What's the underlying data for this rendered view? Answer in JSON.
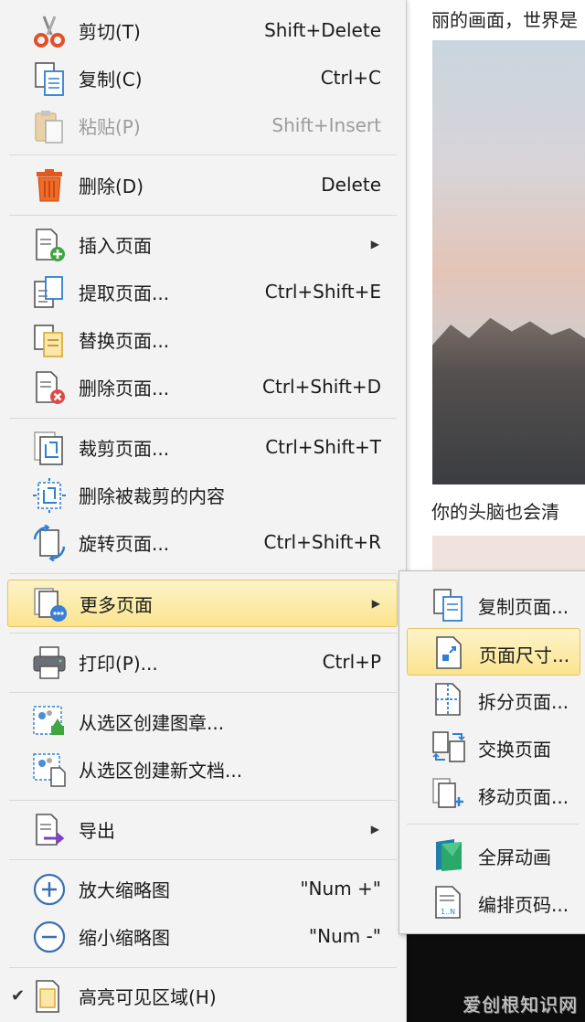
{
  "document": {
    "line1": "丽的画面，世界是",
    "line2": "你的头脑也会清",
    "watermark": "爱创根知识网"
  },
  "menu": {
    "items": [
      {
        "id": "cut",
        "label": "剪切(T)",
        "shortcut": "Shift+Delete"
      },
      {
        "id": "copy",
        "label": "复制(C)",
        "shortcut": "Ctrl+C"
      },
      {
        "id": "paste",
        "label": "粘贴(P)",
        "shortcut": "Shift+Insert"
      },
      {
        "id": "delete",
        "label": "删除(D)",
        "shortcut": "Delete"
      },
      {
        "id": "insert-page",
        "label": "插入页面",
        "shortcut": ""
      },
      {
        "id": "extract-page",
        "label": "提取页面...",
        "shortcut": "Ctrl+Shift+E"
      },
      {
        "id": "replace-page",
        "label": "替换页面...",
        "shortcut": ""
      },
      {
        "id": "delete-page",
        "label": "删除页面...",
        "shortcut": "Ctrl+Shift+D"
      },
      {
        "id": "crop-page",
        "label": "裁剪页面...",
        "shortcut": "Ctrl+Shift+T"
      },
      {
        "id": "delete-cropped",
        "label": "删除被裁剪的内容",
        "shortcut": ""
      },
      {
        "id": "rotate-page",
        "label": "旋转页面...",
        "shortcut": "Ctrl+Shift+R"
      },
      {
        "id": "more-pages",
        "label": "更多页面",
        "shortcut": ""
      },
      {
        "id": "print",
        "label": "打印(P)...",
        "shortcut": "Ctrl+P"
      },
      {
        "id": "create-stamp",
        "label": "从选区创建图章...",
        "shortcut": ""
      },
      {
        "id": "create-doc",
        "label": "从选区创建新文档...",
        "shortcut": ""
      },
      {
        "id": "export",
        "label": "导出",
        "shortcut": ""
      },
      {
        "id": "zoom-in-thumb",
        "label": "放大缩略图",
        "shortcut": "\"Num +\""
      },
      {
        "id": "zoom-out-thumb",
        "label": "缩小缩略图",
        "shortcut": "\"Num -\""
      },
      {
        "id": "highlight-visible",
        "label": "高亮可见区域(H)",
        "shortcut": ""
      }
    ],
    "check_mark": "✔",
    "submenu_arrow": "▶"
  },
  "submenu": {
    "items": [
      {
        "id": "copy-page",
        "label": "复制页面..."
      },
      {
        "id": "page-size",
        "label": "页面尺寸..."
      },
      {
        "id": "split-page",
        "label": "拆分页面..."
      },
      {
        "id": "swap-page",
        "label": "交换页面"
      },
      {
        "id": "move-page",
        "label": "移动页面..."
      },
      {
        "id": "fullscreen-anim",
        "label": "全屏动画"
      },
      {
        "id": "page-numbering",
        "label": "编排页码..."
      }
    ]
  },
  "colors": {
    "highlight_top": "#fdf3c8",
    "highlight_bottom": "#fbe48e",
    "menu_bg": "#f3f3f3",
    "accent_blue": "#2f7fd0"
  }
}
